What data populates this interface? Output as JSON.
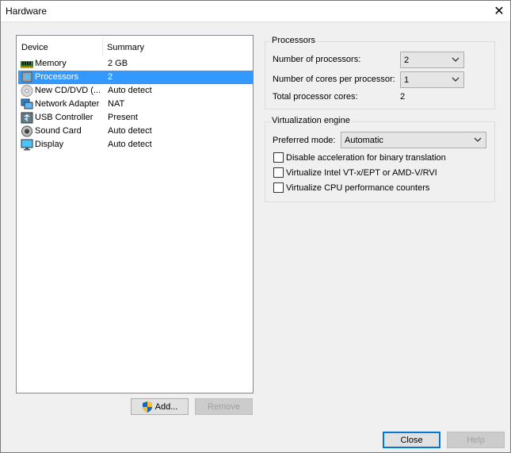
{
  "window": {
    "title": "Hardware",
    "close_glyph": "✕"
  },
  "device_list": {
    "columns": {
      "device": "Device",
      "summary": "Summary"
    },
    "rows": [
      {
        "name": "Memory",
        "summary": "2 GB",
        "icon": "memory-icon"
      },
      {
        "name": "Processors",
        "summary": "2",
        "icon": "processor-icon",
        "selected": true
      },
      {
        "name": "New CD/DVD (...",
        "summary": "Auto detect",
        "icon": "cd-dvd-icon"
      },
      {
        "name": "Network Adapter",
        "summary": "NAT",
        "icon": "network-adapter-icon"
      },
      {
        "name": "USB Controller",
        "summary": "Present",
        "icon": "usb-icon"
      },
      {
        "name": "Sound Card",
        "summary": "Auto detect",
        "icon": "sound-card-icon"
      },
      {
        "name": "Display",
        "summary": "Auto detect",
        "icon": "display-icon"
      }
    ]
  },
  "buttons": {
    "add": "Add...",
    "remove": "Remove",
    "close": "Close",
    "help": "Help"
  },
  "processors": {
    "title": "Processors",
    "num_processors_label": "Number of processors:",
    "num_processors_value": "2",
    "cores_label": "Number of cores per processor:",
    "cores_value": "1",
    "total_label": "Total processor cores:",
    "total_value": "2"
  },
  "virtualization": {
    "title": "Virtualization engine",
    "mode_label": "Preferred mode:",
    "mode_value": "Automatic",
    "options": [
      {
        "label": "Disable acceleration for binary translation",
        "checked": false
      },
      {
        "label": "Virtualize Intel VT-x/EPT or AMD-V/RVI",
        "checked": false
      },
      {
        "label": "Virtualize CPU performance counters",
        "checked": false
      }
    ]
  },
  "colors": {
    "selection": "#3399ff",
    "accent": "#0078d7"
  }
}
